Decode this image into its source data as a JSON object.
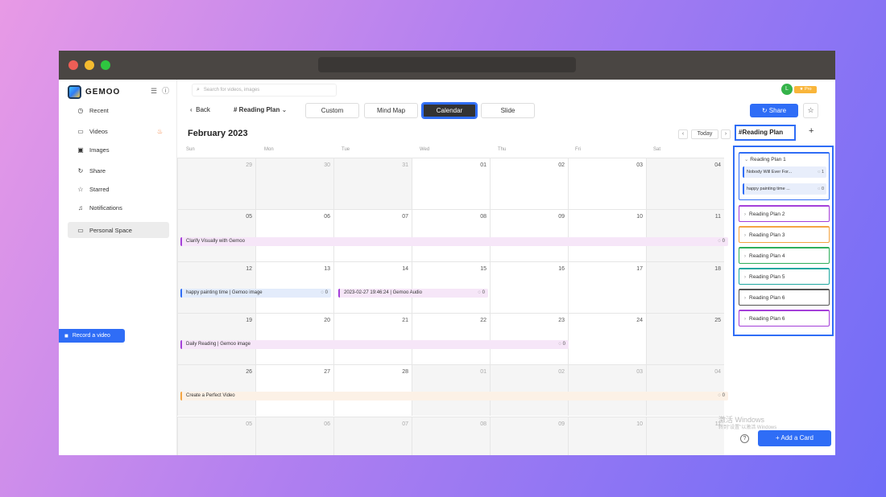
{
  "app": {
    "brand": "GEMOO",
    "pro_badge": "Pro",
    "avatar_letter": "L"
  },
  "sidebar": {
    "items": [
      {
        "label": "Recent",
        "icon": "clock-icon"
      },
      {
        "label": "Videos",
        "icon": "video-icon"
      },
      {
        "label": "Images",
        "icon": "image-icon"
      },
      {
        "label": "Share",
        "icon": "share-icon"
      },
      {
        "label": "Starred",
        "icon": "star-icon"
      },
      {
        "label": "Notifications",
        "icon": "bell-icon"
      },
      {
        "label": "Personal Space",
        "icon": "folder-icon"
      }
    ],
    "record_label": "Record a video"
  },
  "search": {
    "placeholder": "Search for videos, images"
  },
  "toolbar": {
    "back_label": "Back",
    "plan_label": "# Reading Plan",
    "tabs": [
      "Custom",
      "Mind Map",
      "Calendar",
      "Slide"
    ],
    "active_tab": "Calendar",
    "share_label": "Share"
  },
  "calendar": {
    "month": "February 2023",
    "today_label": "Today",
    "weekdays": [
      "Sun",
      "Mon",
      "Tue",
      "Wed",
      "Thu",
      "Fri",
      "Sat"
    ],
    "weeks": [
      [
        "29",
        "30",
        "31",
        "01",
        "02",
        "03",
        "04"
      ],
      [
        "05",
        "06",
        "07",
        "08",
        "09",
        "10",
        "11"
      ],
      [
        "12",
        "13",
        "14",
        "15",
        "16",
        "17",
        "18"
      ],
      [
        "19",
        "20",
        "21",
        "22",
        "23",
        "24",
        "25"
      ],
      [
        "26",
        "27",
        "28",
        "01",
        "02",
        "03",
        "04"
      ],
      [
        "05",
        "06",
        "07",
        "08",
        "09",
        "10",
        "11"
      ]
    ],
    "events": [
      {
        "title": "Clarify Visually with Gemoo",
        "count": "0"
      },
      {
        "title": "happy painting time | Gemoo image",
        "count": "0"
      },
      {
        "title": "2023-02-27 19:46:24 | Gemoo Audio",
        "count": "0"
      },
      {
        "title": "Daily Reading | Gemoo image",
        "count": "0"
      },
      {
        "title": "Create a Perfect Video",
        "count": "0"
      }
    ]
  },
  "panel": {
    "title": "#Reading Plan",
    "plan1": {
      "label": "Reading Plan 1",
      "cards": [
        {
          "title": "Nobody Will Ever For...",
          "count": "1"
        },
        {
          "title": "happy painting time ...",
          "count": "0"
        }
      ]
    },
    "plans": [
      {
        "label": "Reading Plan 2",
        "color": "#a43fd9"
      },
      {
        "label": "Reading Plan 3",
        "color": "#f4a442"
      },
      {
        "label": "Reading Plan 4",
        "color": "#2fae5b"
      },
      {
        "label": "Reading Plan 5",
        "color": "#1fa8a0"
      },
      {
        "label": "Reading Plan 6",
        "color": "#555555"
      },
      {
        "label": "Reading Plan 6",
        "color": "#a43fd9"
      }
    ],
    "add_card_label": "+ Add a Card"
  },
  "watermark": {
    "line1": "激活 Windows",
    "line2": "转到\"设置\"以激活 Windows"
  }
}
